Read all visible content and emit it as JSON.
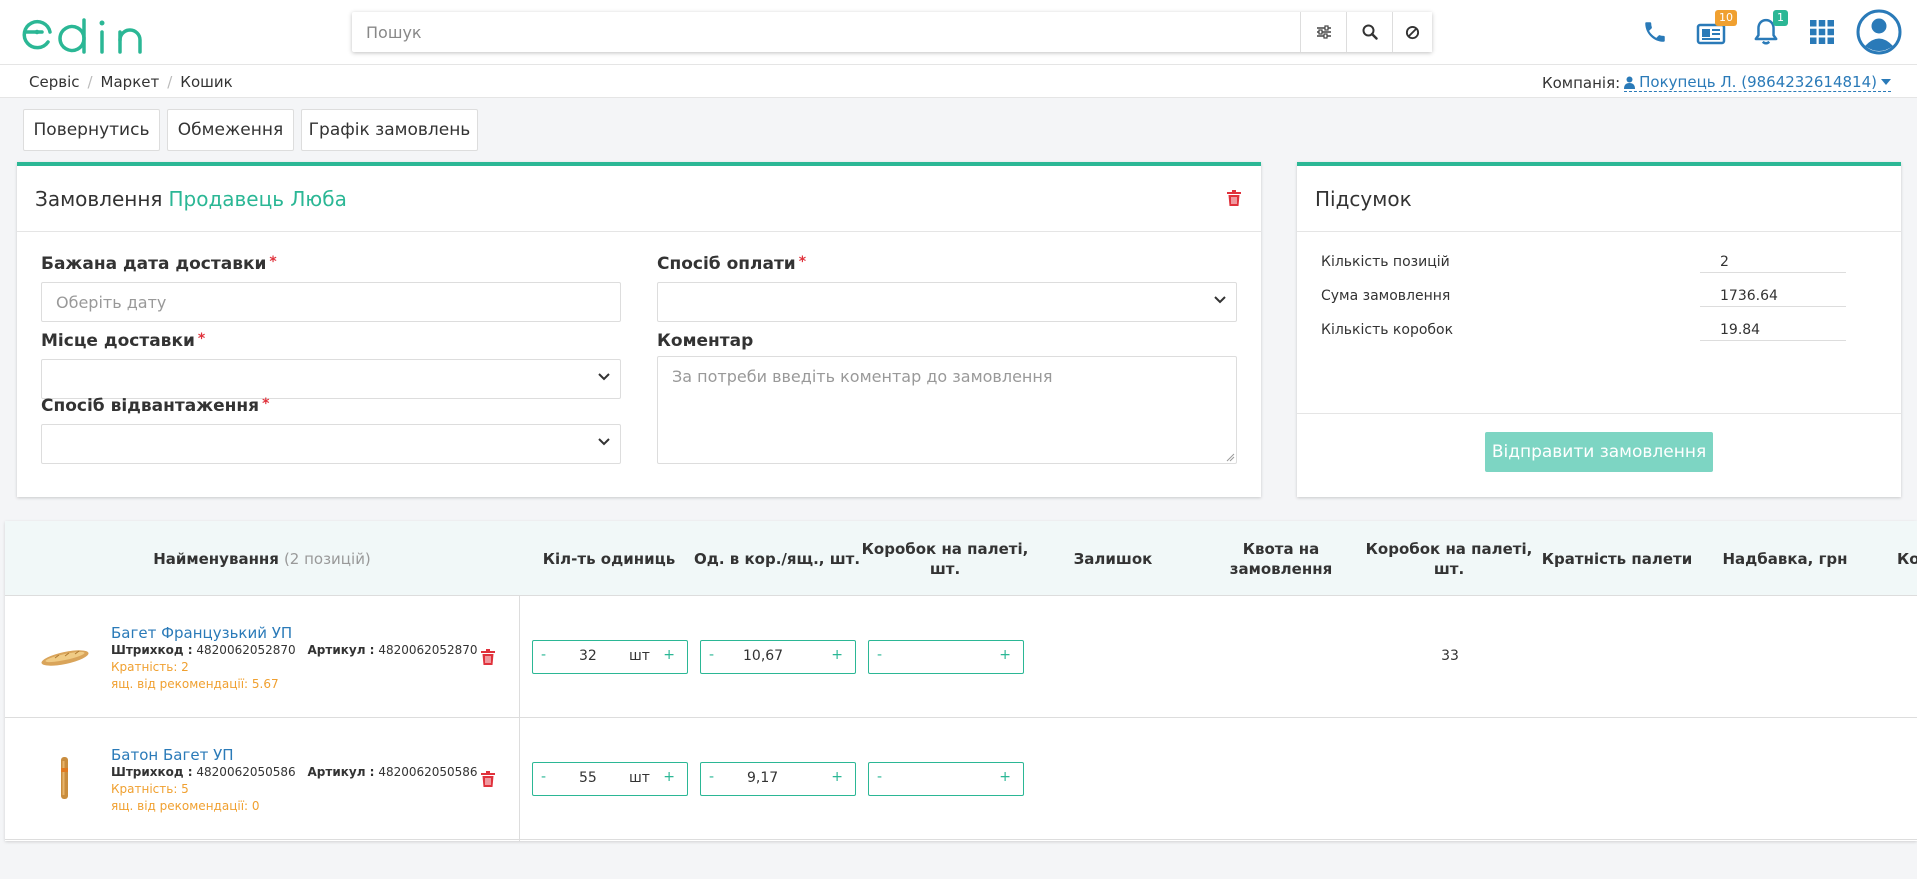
{
  "brand": {
    "logo_text": "edin",
    "accent": "#2bb795",
    "link": "#2a7ab8",
    "danger": "#e0323c",
    "warning": "#f0a030"
  },
  "header": {
    "search_placeholder": "Пошук",
    "icons": [
      "phone-icon",
      "documents-icon",
      "bell-icon",
      "apps-grid-icon",
      "user-avatar-icon"
    ],
    "documents_badge": "10",
    "bell_badge": "1"
  },
  "breadcrumb": [
    "Сервіс",
    "Маркет",
    "Кошик"
  ],
  "company": {
    "label": "Компанія:",
    "value": "Покупець Л. (9864232614814)"
  },
  "toolbar": {
    "back": "Повернутись",
    "limits": "Обмеження",
    "schedule": "Графік замовлень"
  },
  "order": {
    "title": "Замовлення",
    "seller": "Продавець Люба",
    "delivery_date_label": "Бажана дата доставки",
    "delivery_date_placeholder": "Оберіть дату",
    "payment_label": "Спосіб оплати",
    "place_label": "Місце доставки",
    "comment_label": "Коментар",
    "comment_placeholder": "За потреби введіть коментар до замовлення",
    "shipment_label": "Спосіб відвантаження",
    "required_mark": "*"
  },
  "summary": {
    "title": "Підсумок",
    "rows": [
      {
        "label": "Кількість позицій",
        "value": "2"
      },
      {
        "label": "Сума замовлення",
        "value": "1736.64"
      },
      {
        "label": "Кількість коробок",
        "value": "19.84"
      }
    ],
    "submit": "Відправити замовлення"
  },
  "table": {
    "name_header": "Найменування",
    "name_count": "(2 позицій)",
    "columns": [
      "Кіл-ть одиниць",
      "Од. в кор./ящ., шт.",
      "Коробок на палеті, шт.",
      "Залишок",
      "Квота на замовлення",
      "Коробок на палеті, шт.",
      "Кратність палети",
      "Надбавка, грн",
      "Ко"
    ],
    "rows": [
      {
        "name": "Багет Французький УП",
        "barcode_label": "Штрихкод :",
        "barcode": "4820062052870",
        "article_label": "Артикул :",
        "article": "4820062052870",
        "multiplicity": "Кратність:  2",
        "recommend": "ящ. від рекомендації:  5.67",
        "qty": "32",
        "unit": "шт",
        "per_box": "10,67",
        "boxes": "",
        "pallet_boxes": "33"
      },
      {
        "name": "Батон Багет УП",
        "barcode_label": "Штрихкод :",
        "barcode": "4820062050586",
        "article_label": "Артикул :",
        "article": "4820062050586",
        "multiplicity": "Кратність:  5",
        "recommend": "ящ. від рекомендації:  0",
        "qty": "55",
        "unit": "шт",
        "per_box": "9,17",
        "boxes": "",
        "pallet_boxes": ""
      }
    ],
    "minus": "-",
    "plus": "+"
  }
}
